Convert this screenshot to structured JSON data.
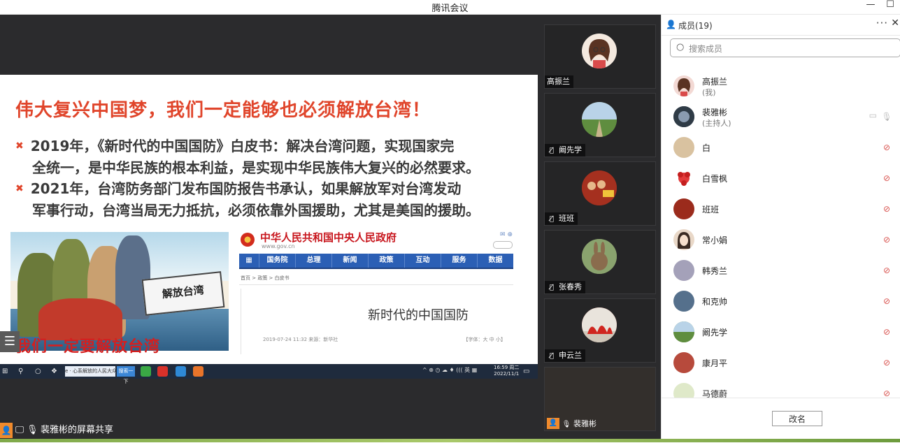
{
  "window": {
    "title": "腾讯会议",
    "minimize": "—",
    "maximize": "☐"
  },
  "slide": {
    "heading": "伟大复兴中国梦，我们一定能够也必须解放台湾！",
    "bullets": [
      {
        "line1": "2019年，《新时代的中国国防》白皮书：解决台湾问题，实现国家完",
        "line2": "全统一，是中华民族的根本利益，是实现中华民族伟大复兴的必然要求。"
      },
      {
        "line1": "2021年，台湾防务部门发布国防报告书承认，如果解放军对台湾发动",
        "line2": "军事行动，台湾当局无力抵抗，必须依靠外国援助，尤其是美国的援助。"
      }
    ],
    "poster_sign": "解放台湾",
    "poster_caption": "我们一定要解放台湾",
    "gov": {
      "site_name": "中华人民共和国中央人民政府",
      "url": "www.gov.cn",
      "nav": [
        "国务院",
        "总理",
        "新闻",
        "政策",
        "互动",
        "服务",
        "数据"
      ],
      "breadcrumb": "首页  >  政策  >  白皮书",
      "doc_title": "新时代的中国国防",
      "meta": "2019-07-24 11:32    来源：新华社",
      "font_size": "【字体：大 中 小】"
    }
  },
  "taskbar": {
    "ie_label": "e · 心系解放的人民大众",
    "search_button": "搜索一下",
    "tray": "^ ⊕ ◷ ☁ ♦ ((( 英 ▦",
    "time": "16:59 周二",
    "date": "2022/11/1"
  },
  "share_bar": {
    "label": "裴雅彬的屏幕共享"
  },
  "video_tiles": [
    {
      "name": "高振兰",
      "muted": false,
      "avatar_color": "#f4e9df"
    },
    {
      "name": "阚先学",
      "muted": true,
      "avatar_color": "#6f9b5a"
    },
    {
      "name": "班班",
      "muted": true,
      "avatar_color": "#9b2b1c"
    },
    {
      "name": "张春秀",
      "muted": true,
      "avatar_color": "#8a9a6a"
    },
    {
      "name": "申云兰",
      "muted": true,
      "avatar_color": "#c8332a"
    },
    {
      "name": "裴雅彬",
      "muted": false,
      "avatar_color": "#302e2c"
    }
  ],
  "members": {
    "title": "成员(19)",
    "search_placeholder": "搜索成员",
    "list": [
      {
        "name": "高振兰",
        "sub": "(我)",
        "avatar_color": "#f3d9d4",
        "muted": false,
        "mic": false
      },
      {
        "name": "裴雅彬",
        "sub": "(主持人)",
        "avatar_color": "#3c4a57",
        "muted": false,
        "mic": true
      },
      {
        "name": "白",
        "sub": "",
        "avatar_color": "#d9c2a0",
        "muted": true,
        "mic": true
      },
      {
        "name": "白雪枫",
        "sub": "",
        "avatar_color": "#e23a3a",
        "muted": true,
        "mic": true
      },
      {
        "name": "班班",
        "sub": "",
        "avatar_color": "#9b2b1c",
        "muted": true,
        "mic": true
      },
      {
        "name": "常小娟",
        "sub": "",
        "avatar_color": "#e9d8c8",
        "muted": true,
        "mic": true
      },
      {
        "name": "韩秀兰",
        "sub": "",
        "avatar_color": "#a4a1b9",
        "muted": true,
        "mic": true
      },
      {
        "name": "和克帅",
        "sub": "",
        "avatar_color": "#55708c",
        "muted": true,
        "mic": true
      },
      {
        "name": "阚先学",
        "sub": "",
        "avatar_color": "#6f9b5a",
        "muted": true,
        "mic": true
      },
      {
        "name": "康月平",
        "sub": "",
        "avatar_color": "#b74a3c",
        "muted": true,
        "mic": true
      },
      {
        "name": "马德蔚",
        "sub": "",
        "avatar_color": "#dfe9c9",
        "muted": true,
        "mic": true
      }
    ],
    "rename_button": "改名"
  },
  "icons": {
    "person": "person-icon",
    "more": "more-icon",
    "close": "close-icon",
    "search": "search-icon",
    "mic": "mic-icon",
    "mic_muted": "mic-muted-icon",
    "screen": "screen-share-icon"
  }
}
